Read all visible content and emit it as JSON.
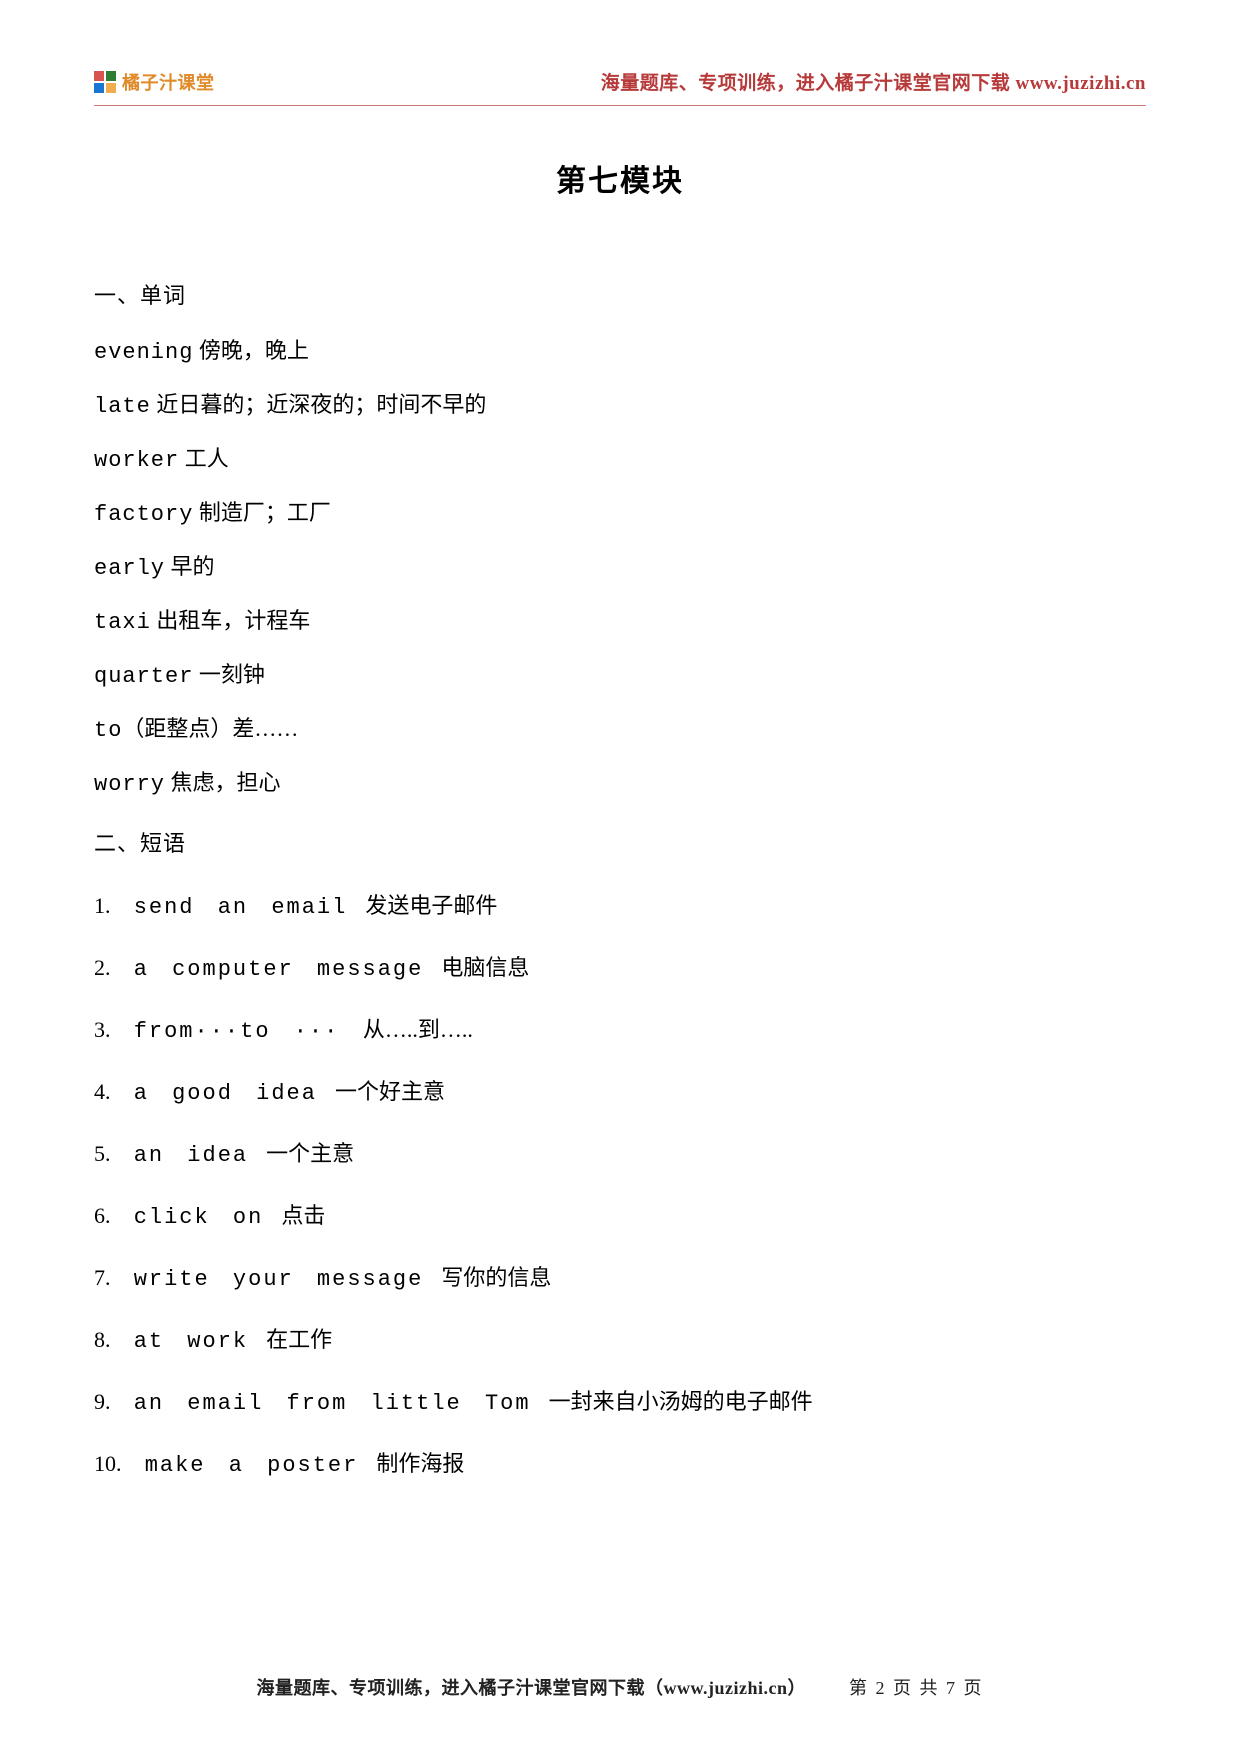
{
  "header": {
    "brand": "橘子汁课堂",
    "right": "海量题库、专项训练，进入橘子汁课堂官网下载 www.juzizhi.cn"
  },
  "title": "第七模块",
  "section1": {
    "heading": "一、单词",
    "items": [
      {
        "en": "evening",
        "cn": " 傍晚，晚上"
      },
      {
        "en": "late",
        "cn": " 近日暮的；近深夜的；时间不早的"
      },
      {
        "en": "worker",
        "cn": " 工人"
      },
      {
        "en": "factory",
        "cn": " 制造厂；工厂"
      },
      {
        "en": "early",
        "cn": " 早的"
      },
      {
        "en": "taxi",
        "cn": " 出租车，计程车"
      },
      {
        "en": "quarter",
        "cn": " 一刻钟"
      },
      {
        "en": "to",
        "cn": "（距整点）差……"
      },
      {
        "en": "worry",
        "cn": " 焦虑，担心"
      }
    ]
  },
  "section2": {
    "heading": "二、短语",
    "items": [
      {
        "num": "1.",
        "en": " send  an  email",
        "cn": "发送电子邮件"
      },
      {
        "num": "2.",
        "en": " a  computer  message",
        "cn": "电脑信息"
      },
      {
        "num": "3.",
        "en": " from···to  ···",
        "cn": "   从…..到….."
      },
      {
        "num": "4.",
        "en": " a  good  idea",
        "cn": "一个好主意"
      },
      {
        "num": "5.",
        "en": " an  idea",
        "cn": "一个主意"
      },
      {
        "num": "6.",
        "en": " click  on",
        "cn": "点击"
      },
      {
        "num": "7.",
        "en": " write  your  message",
        "cn": "写你的信息"
      },
      {
        "num": "8.",
        "en": " at  work",
        "cn": "在工作"
      },
      {
        "num": "9.",
        "en": " an  email  from  little  Tom",
        "cn": "一封来自小汤姆的电子邮件"
      },
      {
        "num": "10.",
        "en": " make  a  poster",
        "cn": "制作海报"
      }
    ]
  },
  "footer": {
    "left": "海量题库、专项训练，进入橘子汁课堂官网下载（www.juzizhi.cn）",
    "page": "第 2 页 共 7 页"
  }
}
